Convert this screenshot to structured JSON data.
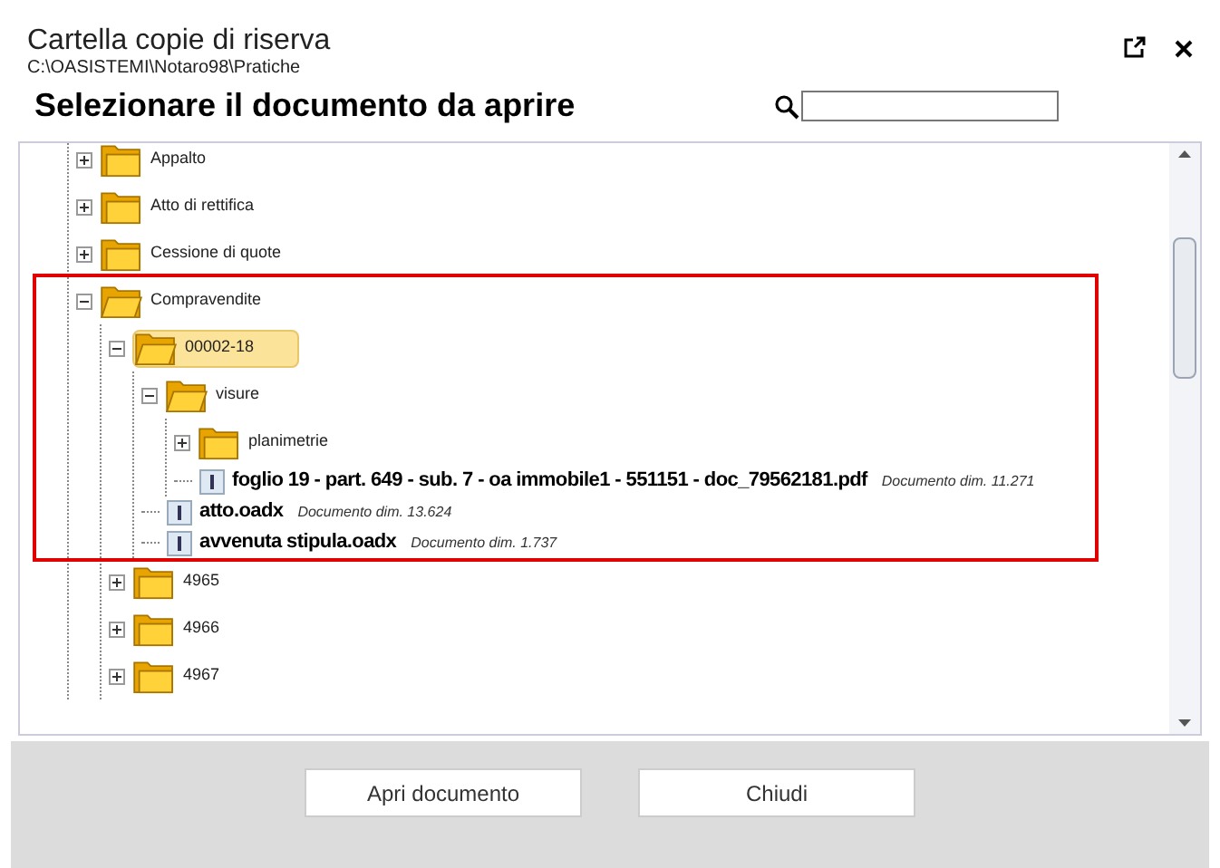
{
  "window": {
    "title": "Cartella copie di riserva",
    "path": "C:\\OASISTEMI\\Notaro98\\Pratiche"
  },
  "heading": "Selezionare il documento da aprire",
  "tree": [
    {
      "kind": "folder",
      "name": "Appalto",
      "expanded": false,
      "selected": false
    },
    {
      "kind": "folder",
      "name": "Atto di rettifica",
      "expanded": false,
      "selected": false
    },
    {
      "kind": "folder",
      "name": "Cessione di quote",
      "expanded": false,
      "selected": false
    },
    {
      "kind": "folder",
      "name": "Compravendite",
      "expanded": true,
      "selected": false,
      "children": [
        {
          "kind": "folder",
          "name": "00002-18",
          "expanded": true,
          "selected": true,
          "children": [
            {
              "kind": "folder",
              "name": "visure",
              "expanded": true,
              "selected": false,
              "children": [
                {
                  "kind": "folder",
                  "name": "planimetrie",
                  "expanded": false,
                  "selected": false
                },
                {
                  "kind": "file",
                  "name": "foglio 19 -  part. 649 -  sub. 7 - oa immobile1 - 551151 - doc_79562181.pdf",
                  "size": "Documento dim.  11.271",
                  "selected": false
                }
              ]
            },
            {
              "kind": "file",
              "name": "atto.oadx",
              "size": "Documento dim.  13.624",
              "selected": false
            },
            {
              "kind": "file",
              "name": "avvenuta stipula.oadx",
              "size": "Documento dim.  1.737",
              "selected": false
            }
          ]
        },
        {
          "kind": "folder",
          "name": "4965",
          "expanded": false,
          "selected": false
        },
        {
          "kind": "folder",
          "name": "4966",
          "expanded": false,
          "selected": false
        },
        {
          "kind": "folder",
          "name": "4967",
          "expanded": false,
          "selected": false
        }
      ]
    }
  ],
  "buttons": [
    "Apri documento",
    "Chiudi"
  ]
}
